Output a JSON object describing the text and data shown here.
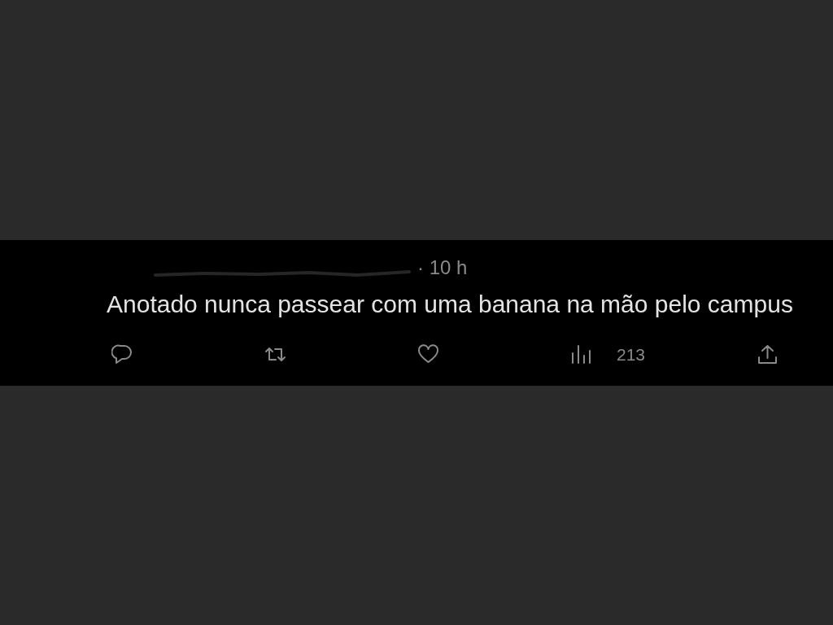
{
  "post": {
    "time": "· 10 h",
    "text": "Anotado nunca passear com uma banana na mão pelo campus",
    "actions": [
      {
        "kind": "reply"
      },
      {
        "kind": "repost"
      },
      {
        "kind": "like"
      },
      {
        "kind": "views",
        "count": "213"
      },
      {
        "kind": "share"
      }
    ]
  }
}
